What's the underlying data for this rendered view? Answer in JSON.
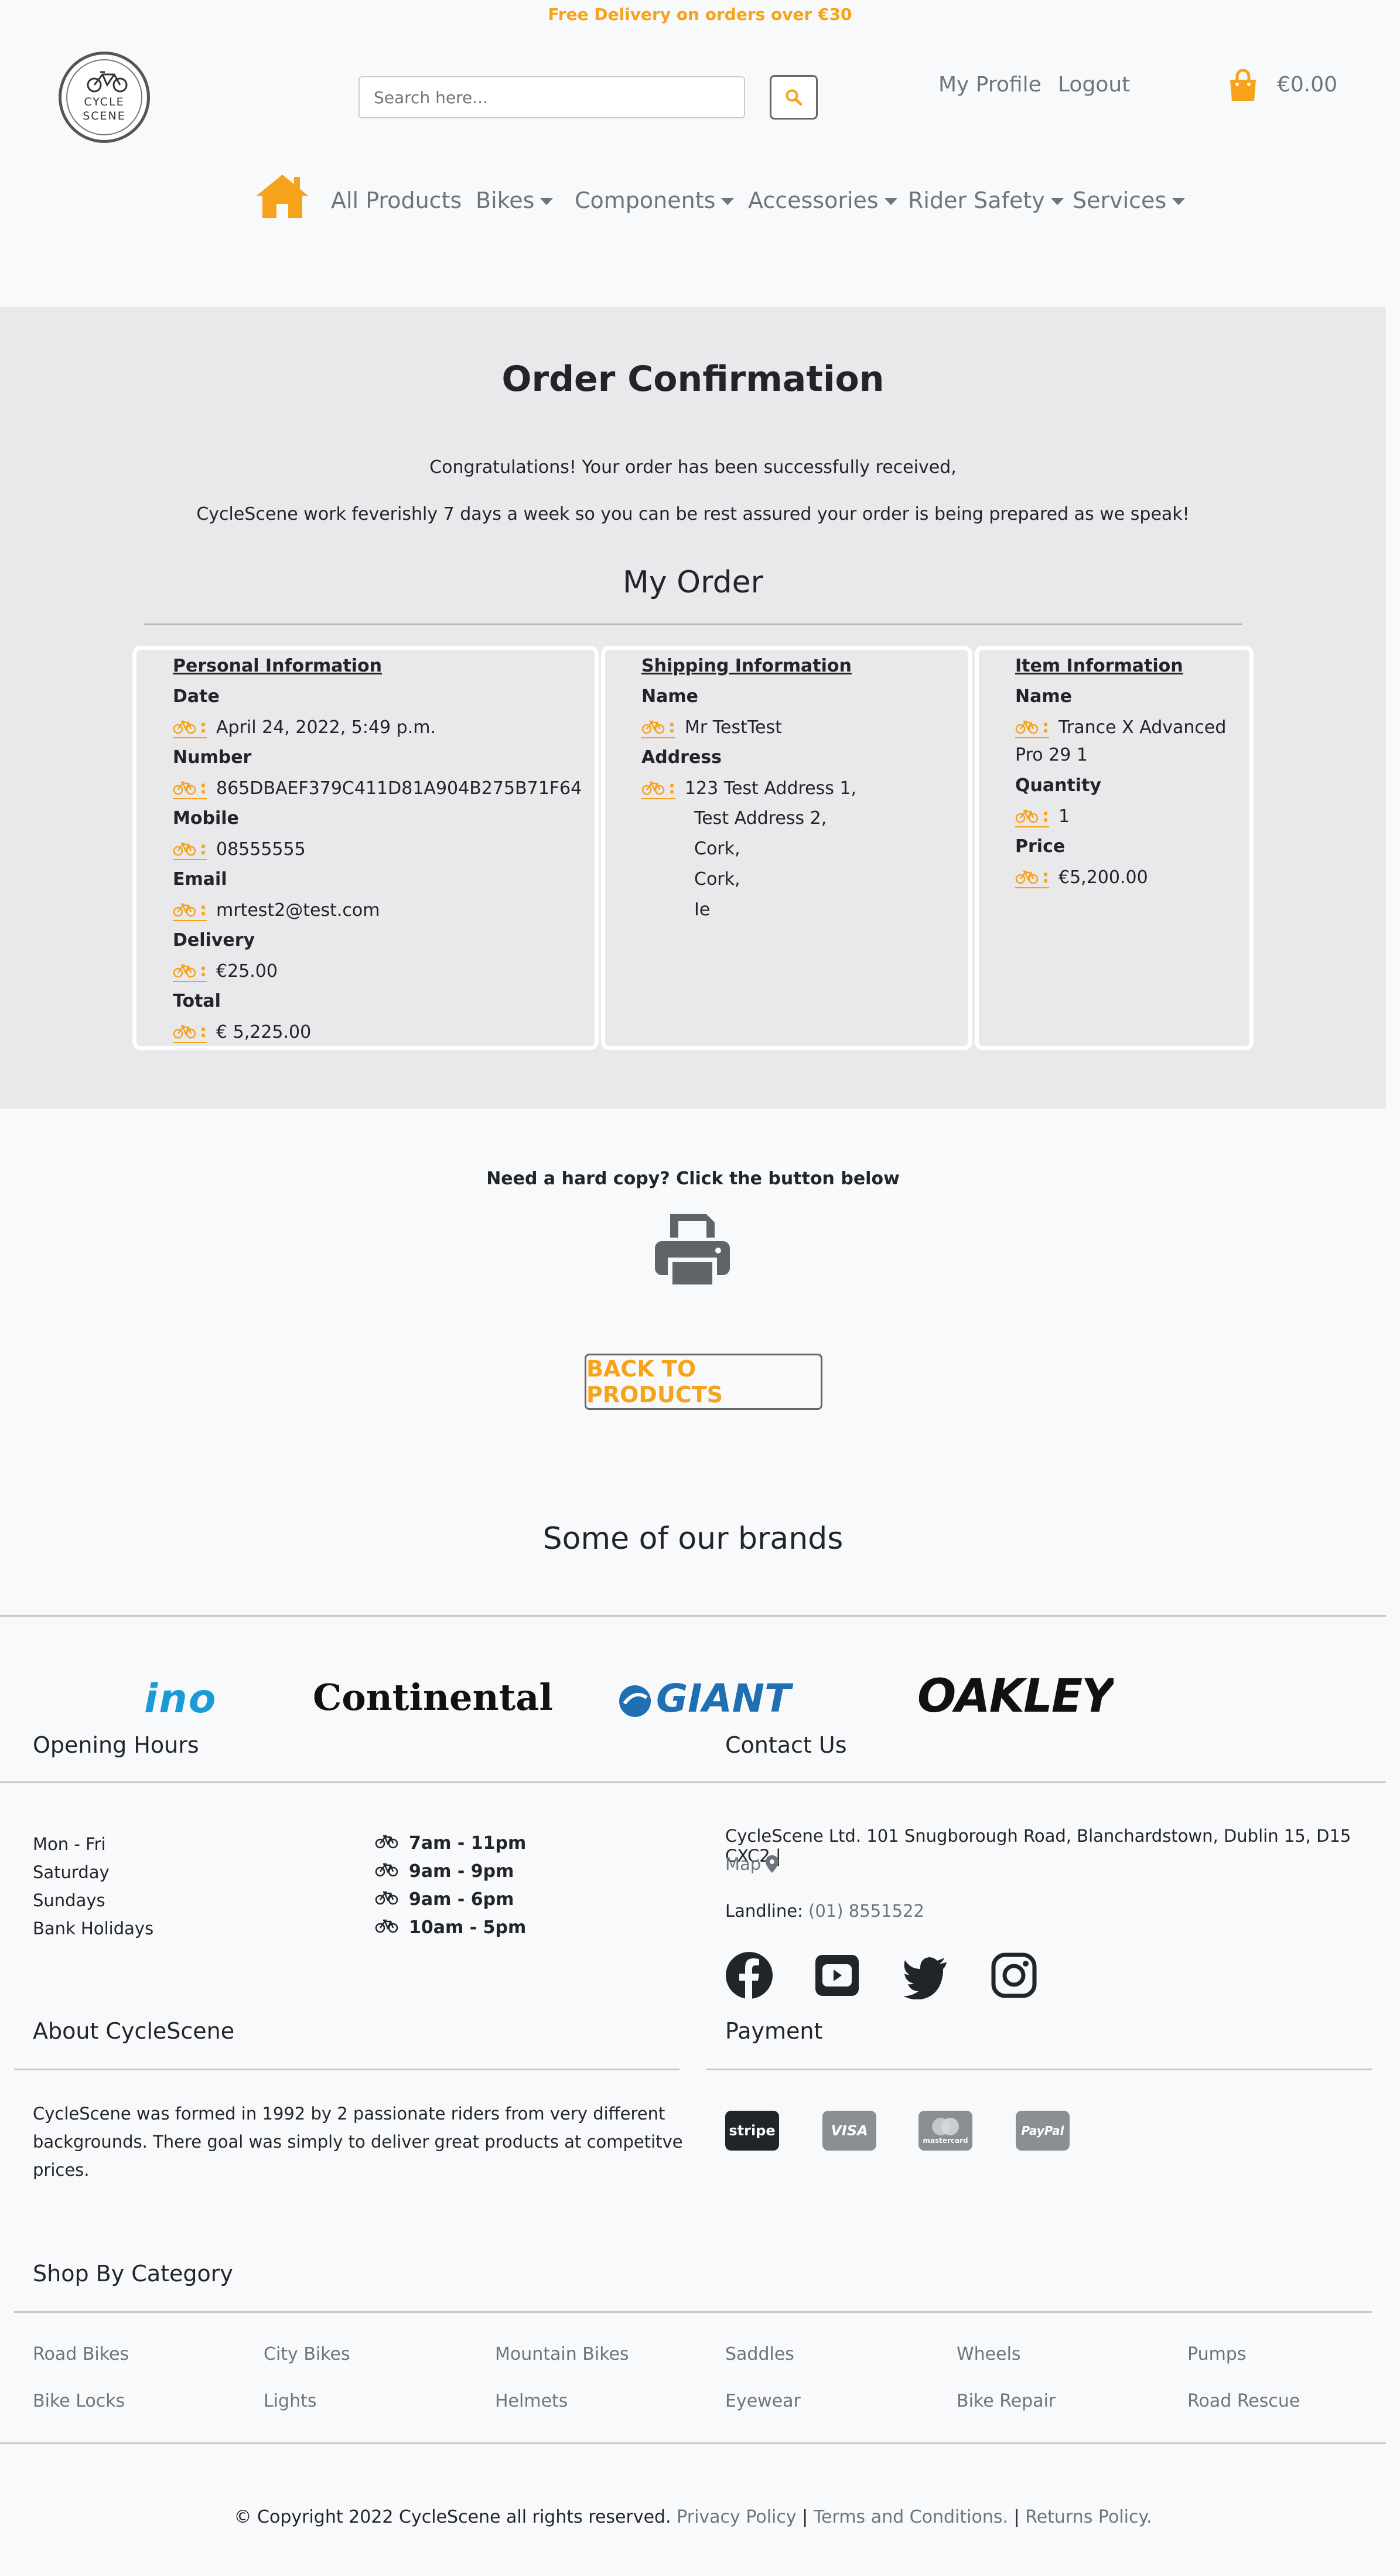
{
  "promo": "Free Delivery on orders over €30",
  "logo": {
    "line1": "CYCLE",
    "line2": "SCENE"
  },
  "search": {
    "placeholder": "Search here...",
    "button_icon": "search-icon"
  },
  "account": {
    "profile": "My Profile",
    "logout": "Logout"
  },
  "cart": {
    "total": "€0.00",
    "icon": "shopping-bag-icon"
  },
  "nav": {
    "home_icon": "home-icon",
    "items": [
      {
        "label": "All Products",
        "dropdown": false
      },
      {
        "label": "Bikes",
        "dropdown": true
      },
      {
        "label": "Components",
        "dropdown": true
      },
      {
        "label": "Accessories",
        "dropdown": true
      },
      {
        "label": "Rider Safety",
        "dropdown": true
      },
      {
        "label": "Services",
        "dropdown": true
      }
    ]
  },
  "order": {
    "title": "Order Confirmation",
    "message1": "Congratulations! Your order has been successfully received,",
    "message2": "CycleScene work feverishly 7 days a week so you can be rest assured your order is being prepared as we speak!",
    "subtitle": "My Order",
    "personal": {
      "title": "Personal Information",
      "date_label": "Date",
      "date": "April 24, 2022, 5:49 p.m.",
      "number_label": "Number",
      "number": "865DBAEF379C411D81A904B275B71F64",
      "mobile_label": "Mobile",
      "mobile": "08555555",
      "email_label": "Email",
      "email": "mrtest2@test.com",
      "delivery_label": "Delivery",
      "delivery": "€25.00",
      "total_label": "Total",
      "total": "€ 5,225.00"
    },
    "shipping": {
      "title": "Shipping Information",
      "name_label": "Name",
      "name": "Mr TestTest",
      "address_label": "Address",
      "address_lines": [
        "123 Test Address 1,",
        "Test Address 2,",
        "Cork,",
        "Cork,",
        "Ie"
      ]
    },
    "item": {
      "title": "Item Information",
      "name_label": "Name",
      "name_line1": "Trance X Advanced",
      "name_line2": "Pro 29 1",
      "quantity_label": "Quantity",
      "quantity": "1",
      "price_label": "Price",
      "price": "€5,200.00"
    },
    "marker_text": ":"
  },
  "hardcopy": {
    "text": "Need a hard copy? Click the button below",
    "icon": "printer-icon"
  },
  "back_button": "BACK TO PRODUCTS",
  "brands": {
    "title": "Some of our brands",
    "logos": [
      "ino",
      "Continental",
      "GIANT",
      "OAKLEY"
    ]
  },
  "footer": {
    "hours_title": "Opening Hours",
    "hours": [
      {
        "day": "Mon - Fri",
        "time": "7am - 11pm"
      },
      {
        "day": "Saturday",
        "time": "9am - 9pm"
      },
      {
        "day": "Sundays",
        "time": "9am - 6pm"
      },
      {
        "day": "Bank Holidays",
        "time": "10am - 5pm"
      }
    ],
    "contact_title": "Contact Us",
    "address": "CycleScene Ltd. 101 Snugborough Road, Blanchardstown, Dublin 15, D15 CXC2 |",
    "map_label": "Map",
    "landline_label": "Landline:",
    "landline": "(01) 8551522",
    "socials": [
      "facebook-icon",
      "youtube-icon",
      "twitter-icon",
      "instagram-icon"
    ],
    "about_title": "About CycleScene",
    "about_lines": [
      "CycleScene was formed in 1992 by 2 passionate riders from very different",
      "backgrounds. There goal was simply to deliver great products at competitve",
      "prices."
    ],
    "payment_title": "Payment",
    "payments": [
      "stripe",
      "VISA",
      "mastercard",
      "PayPal"
    ],
    "category_title": "Shop By Category",
    "categories": [
      "Road Bikes",
      "City Bikes",
      "Mountain Bikes",
      "Saddles",
      "Wheels",
      "Pumps",
      "Bike Locks",
      "Lights",
      "Helmets",
      "Eyewear",
      "Bike Repair",
      "Road Rescue"
    ],
    "copyright": "© Copyright 2022 CycleScene all rights reserved.",
    "privacy": "Privacy Policy",
    "terms": "Terms and Conditions.",
    "returns": "Returns Policy.",
    "separator": "|"
  },
  "colors": {
    "accent": "#f7a21b",
    "muted": "#6c757d",
    "band": "#e9e9eb"
  }
}
